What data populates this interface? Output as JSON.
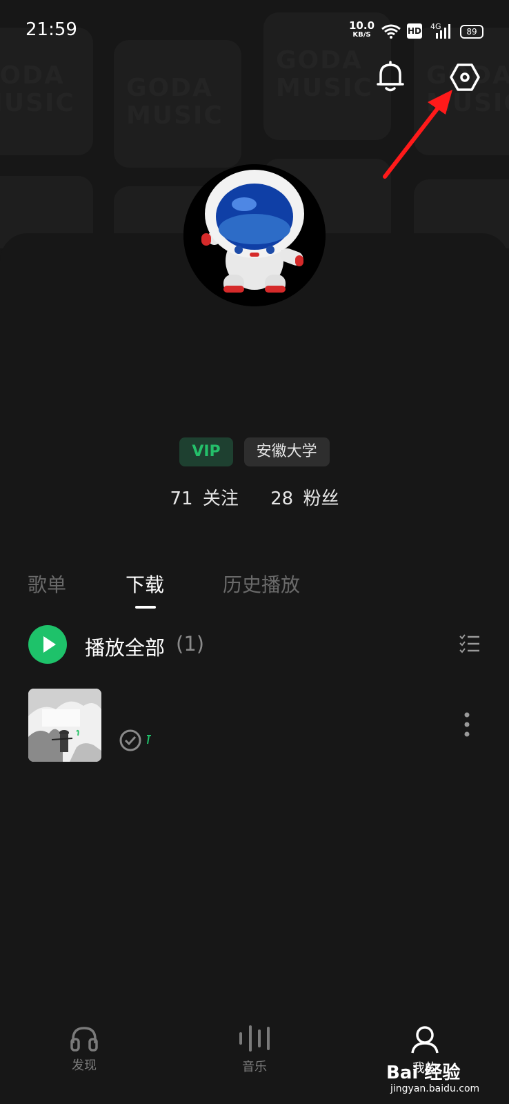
{
  "status_bar": {
    "time": "21:59",
    "net_speed": "10.0",
    "net_speed_unit": "KB/S",
    "hd": "HD",
    "network_type": "4G",
    "battery": "89"
  },
  "background_tiles": [
    "GODA MUSIC",
    "GODA MUSIC",
    "GODA MUSIC",
    "GODA MUSIC"
  ],
  "header": {
    "bell_icon": "bell-icon",
    "settings_icon": "settings-hexagon-icon"
  },
  "profile": {
    "avatar_icon": "astronaut-avatar",
    "badges": {
      "vip": "VIP",
      "school": "安徽大学"
    },
    "following_count": "71",
    "following_label": "关注",
    "followers_count": "28",
    "followers_label": "粉丝"
  },
  "tabs": [
    {
      "label": "歌单",
      "active": false
    },
    {
      "label": "下载",
      "active": true
    },
    {
      "label": "历史播放",
      "active": false
    }
  ],
  "play_all": {
    "label": "播放全部",
    "count": "(1)"
  },
  "songs": [
    {
      "cover": "ink-painting-cover",
      "title": "",
      "status_icon": "downloaded-check-icon"
    }
  ],
  "bottom_nav": [
    {
      "label": "发现",
      "icon": "headphones-icon",
      "active": false
    },
    {
      "label": "音乐",
      "icon": "equalizer-icon",
      "active": false
    },
    {
      "label": "我的",
      "icon": "profile-icon",
      "active": true
    }
  ],
  "watermark": {
    "brand": "Bai 经验",
    "url": "jingyan.baidu.com"
  },
  "colors": {
    "accent": "#1ec26a",
    "background": "#171717",
    "annotation": "#ff1a1a"
  }
}
